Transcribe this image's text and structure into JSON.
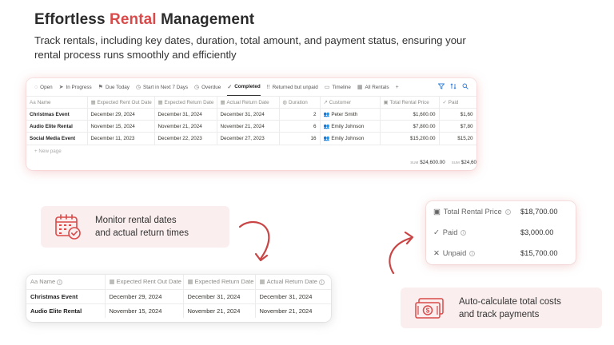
{
  "headline": {
    "before": "Effortless ",
    "accent": "Rental",
    "after": " Management"
  },
  "subline": "Track rentals, including key dates, duration, total amount, and payment status, ensuring your rental process runs smoothly and efficiently",
  "colors": {
    "accent": "#d94a4a",
    "callout_bg": "#fbeeee",
    "tool_blue": "#2f7fd8"
  },
  "main_table": {
    "tabs": [
      {
        "icon": "circle-icon",
        "glyph": "◌",
        "label": "Open"
      },
      {
        "icon": "progress-icon",
        "glyph": "➤",
        "label": "In Progress"
      },
      {
        "icon": "flag-icon",
        "glyph": "⚑",
        "label": "Due Today"
      },
      {
        "icon": "clock-icon",
        "glyph": "◷",
        "label": "Start in Next 7 Days"
      },
      {
        "icon": "clock-icon",
        "glyph": "◷",
        "label": "Overdue"
      },
      {
        "icon": "check-icon",
        "glyph": "✓",
        "label": "Completed"
      },
      {
        "icon": "exclamation-icon",
        "glyph": "!!",
        "label": "Returned but unpaid"
      },
      {
        "icon": "timeline-icon",
        "glyph": "▭",
        "label": "Timeline"
      },
      {
        "icon": "table-icon",
        "glyph": "▦",
        "label": "All Rentals"
      }
    ],
    "add_tab": "+",
    "active_tab": 5,
    "columns": [
      {
        "icon": "Aa",
        "label": "Name"
      },
      {
        "icon": "▦",
        "label": "Expected Rent Out Date"
      },
      {
        "icon": "▦",
        "label": "Expected Return Date"
      },
      {
        "icon": "▦",
        "label": "Actual Return Date"
      },
      {
        "icon": "◍",
        "label": "Duration"
      },
      {
        "icon": "↗",
        "label": "Customer"
      },
      {
        "icon": "▣",
        "label": "Total Rental Price"
      },
      {
        "icon": "✓",
        "label": "Paid"
      }
    ],
    "rows": [
      {
        "name": "Christmas Event",
        "rent_out": "December 29, 2024",
        "exp_return": "December 31, 2024",
        "act_return": "December 31, 2024",
        "duration": "2",
        "customer": "Peter Smith",
        "price": "$1,600.00",
        "paid": "$1,60"
      },
      {
        "name": "Audio Elite Rental",
        "rent_out": "November 15, 2024",
        "exp_return": "November 21, 2024",
        "act_return": "November 21, 2024",
        "duration": "6",
        "customer": "Emily Johnson",
        "price": "$7,800.00",
        "paid": "$7,80"
      },
      {
        "name": "Social Media Event",
        "rent_out": "December 11, 2023",
        "exp_return": "December 22, 2023",
        "act_return": "December 27, 2023",
        "duration": "16",
        "customer": "Emily Johnson",
        "price": "$15,200.00",
        "paid": "$15,20"
      }
    ],
    "new_page": "+ New page",
    "sum_label": "SUM",
    "sum_price": "$24,600.00",
    "sum_paid": "$24,60"
  },
  "zoom_table": {
    "columns": [
      {
        "icon": "Aa",
        "label": "Name"
      },
      {
        "icon": "▦",
        "label": "Expected Rent Out Date"
      },
      {
        "icon": "▦",
        "label": "Expected Return Date"
      },
      {
        "icon": "▦",
        "label": "Actual Return Date"
      }
    ],
    "rows": [
      {
        "name": "Christmas Event",
        "rent_out": "December 29, 2024",
        "exp_return": "December 31, 2024",
        "act_return": "December 31, 2024"
      },
      {
        "name": "Audio Elite Rental",
        "rent_out": "November 15, 2024",
        "exp_return": "November 21, 2024",
        "act_return": "November 21, 2024"
      }
    ]
  },
  "totals": [
    {
      "icon": "money-icon",
      "glyph": "▣",
      "label": "Total Rental Price",
      "value": "$18,700.00"
    },
    {
      "icon": "check-icon",
      "glyph": "✓",
      "label": "Paid",
      "value": "$3,000.00"
    },
    {
      "icon": "x-icon",
      "glyph": "✕",
      "label": "Unpaid",
      "value": "$15,700.00"
    }
  ],
  "info_glyph": "i",
  "callouts": {
    "dates": {
      "line1": "Monitor rental dates",
      "line2": "and actual return times",
      "icon": "calendar-check-icon"
    },
    "costs": {
      "line1": "Auto-calculate total costs",
      "line2": "and track payments",
      "icon": "cash-icon"
    }
  }
}
